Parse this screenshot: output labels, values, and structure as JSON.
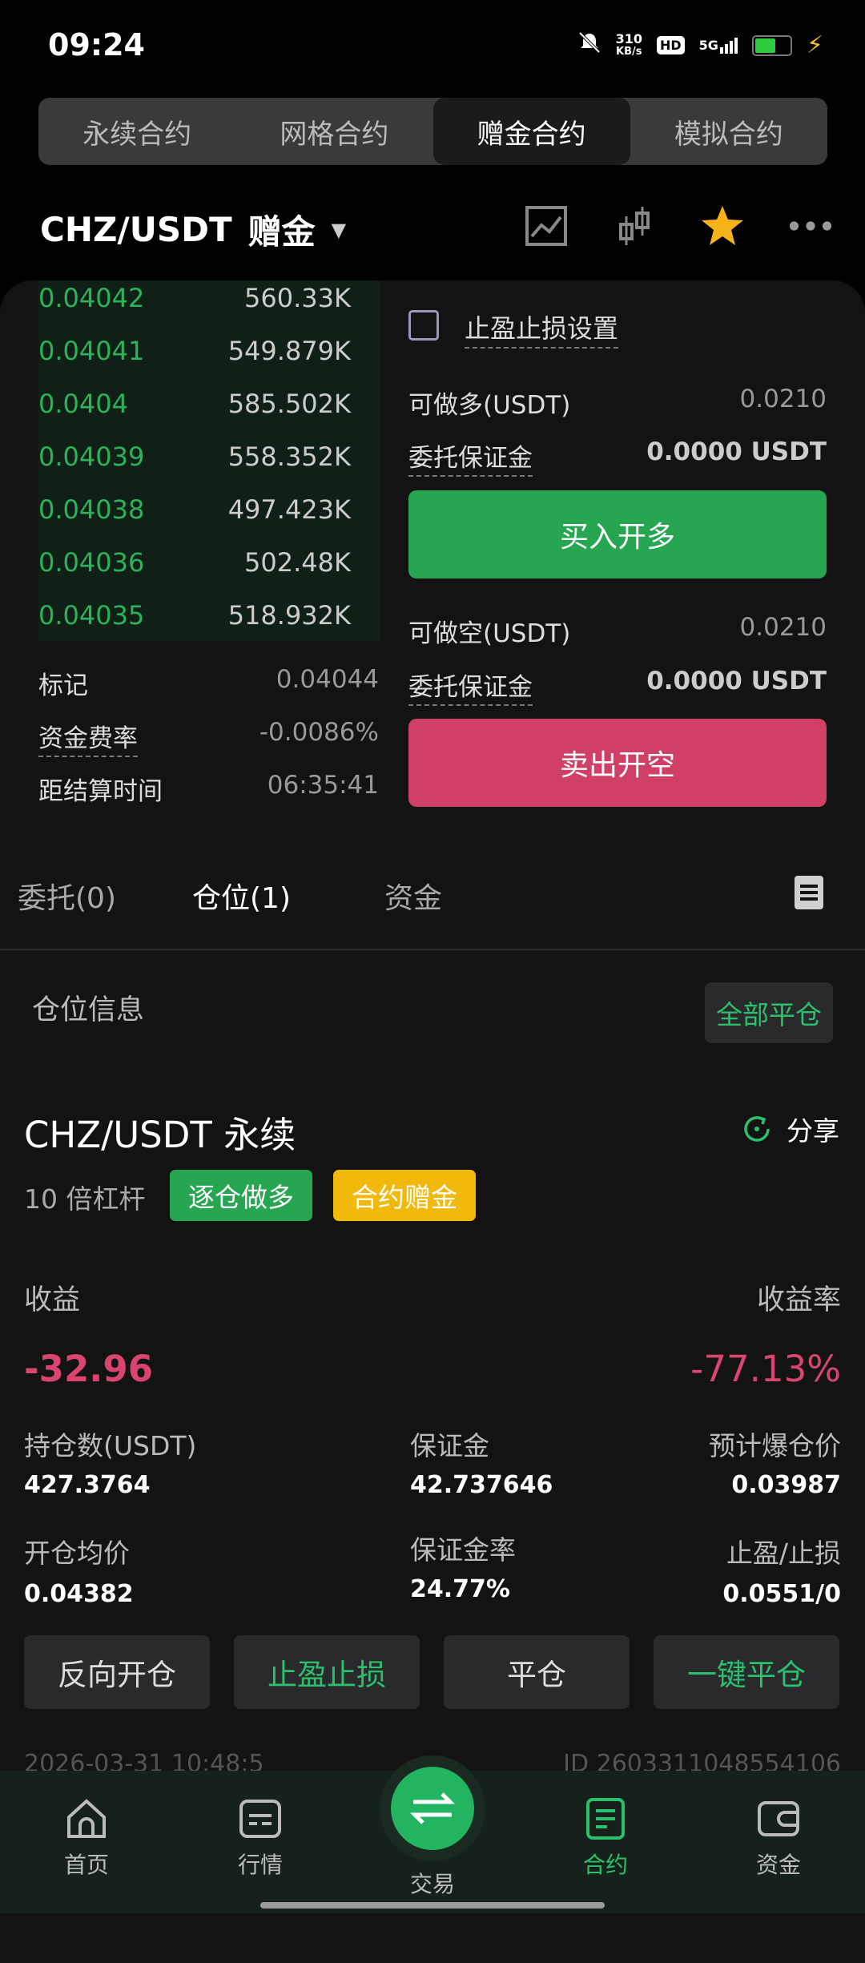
{
  "status": {
    "time": "09:24",
    "speed_top": "310",
    "speed_bottom": "KB/s",
    "hd": "HD",
    "net": "5G"
  },
  "tabs": [
    "永续合约",
    "网格合约",
    "赠金合约",
    "模拟合约"
  ],
  "header": {
    "pair": "CHZ/USDT",
    "mode": "赠金"
  },
  "orderbook": [
    {
      "price": "0.04042",
      "qty": "560.33K"
    },
    {
      "price": "0.04041",
      "qty": "549.879K"
    },
    {
      "price": "0.0404",
      "qty": "585.502K"
    },
    {
      "price": "0.04039",
      "qty": "558.352K"
    },
    {
      "price": "0.04038",
      "qty": "497.423K"
    },
    {
      "price": "0.04036",
      "qty": "502.48K"
    },
    {
      "price": "0.04035",
      "qty": "518.932K"
    }
  ],
  "info": {
    "mark_label": "标记",
    "mark_value": "0.04044",
    "funding_label": "资金费率",
    "funding_value": "-0.0086%",
    "settle_label": "距结算时间",
    "settle_value": "06:35:41"
  },
  "order": {
    "tpsl_label": "止盈止损设置",
    "long_avail_label": "可做多(USDT)",
    "long_avail_value": "0.0210",
    "margin_label": "委托保证金",
    "margin_value": "0.0000 USDT",
    "buy_label": "买入开多",
    "short_avail_label": "可做空(USDT)",
    "short_avail_value": "0.0210",
    "margin_label2": "委托保证金",
    "margin_value2": "0.0000 USDT",
    "sell_label": "卖出开空"
  },
  "subtabs": [
    "委托(0)",
    "仓位(1)",
    "资金"
  ],
  "position": {
    "title": "仓位信息",
    "close_all": "全部平仓",
    "symbol": "CHZ/USDT 永续",
    "share": "分享",
    "leverage": "10 倍杠杆",
    "badge1": "逐仓做多",
    "badge2": "合约赠金",
    "pnl_label": "收益",
    "pnl_rate_label": "收益率",
    "pnl_value": "-32.96",
    "pnl_rate_value": "-77.13%",
    "size_label": "持仓数(USDT)",
    "size_value": "427.3764",
    "margin_label": "保证金",
    "margin_value": "42.737646",
    "liq_label": "预计爆仓价",
    "liq_value": "0.03987",
    "entry_label": "开仓均价",
    "entry_value": "0.04382",
    "margin_rate_label": "保证金率",
    "margin_rate_value": "24.77%",
    "tpsl_label": "止盈/止损",
    "tpsl_value": "0.0551/0",
    "actions": [
      "反向开仓",
      "止盈止损",
      "平仓",
      "一键平仓"
    ],
    "footer_left": "2026-03-31 10:48:5",
    "footer_right": "ID 2603311048554106"
  },
  "nav": [
    "首页",
    "行情",
    "交易",
    "合约",
    "资金"
  ],
  "colors": {
    "green": "#26a651",
    "red": "#cf3f66",
    "yellow": "#f0b90b"
  }
}
